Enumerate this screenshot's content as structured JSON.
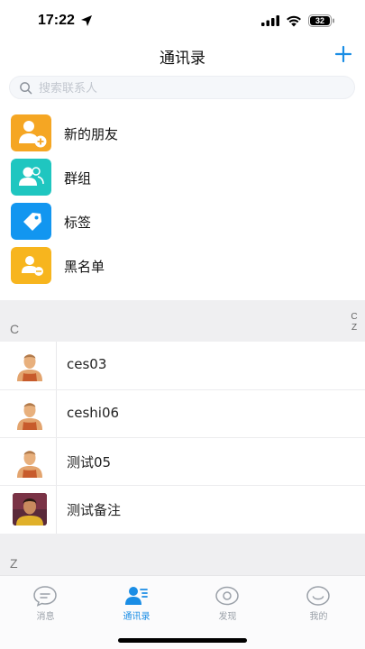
{
  "status_bar": {
    "time": "17:22",
    "battery": "32"
  },
  "header": {
    "title": "通讯录"
  },
  "search": {
    "placeholder": "搜索联系人"
  },
  "menu": [
    {
      "label": "新的朋友",
      "icon": "new-friend-icon",
      "color": "#f5a623"
    },
    {
      "label": "群组",
      "icon": "group-icon",
      "color": "#1fc6c0"
    },
    {
      "label": "标签",
      "icon": "tag-icon",
      "color": "#1296f0"
    },
    {
      "label": "黑名单",
      "icon": "blacklist-icon",
      "color": "#f7b51e"
    }
  ],
  "sections": [
    {
      "letter": "C"
    },
    {
      "letter": "Z"
    }
  ],
  "index_bar": [
    "C",
    "Z"
  ],
  "contacts": [
    {
      "name": "ces03",
      "avatar": "default-avatar-icon"
    },
    {
      "name": "ceshi06",
      "avatar": "default-avatar-icon"
    },
    {
      "name": "测试05",
      "avatar": "default-avatar-icon"
    },
    {
      "name": "测试备注",
      "avatar": "photo-avatar"
    }
  ],
  "tab_bar": {
    "tabs": [
      {
        "label": "消息",
        "icon": "message-icon",
        "active": false
      },
      {
        "label": "通讯录",
        "icon": "contacts-icon",
        "active": true
      },
      {
        "label": "发现",
        "icon": "discover-icon",
        "active": false
      },
      {
        "label": "我的",
        "icon": "profile-icon",
        "active": false
      }
    ],
    "active_color": "#1a8de5",
    "inactive_color": "#9aa0a8"
  },
  "accent_color": "#1a8de5"
}
